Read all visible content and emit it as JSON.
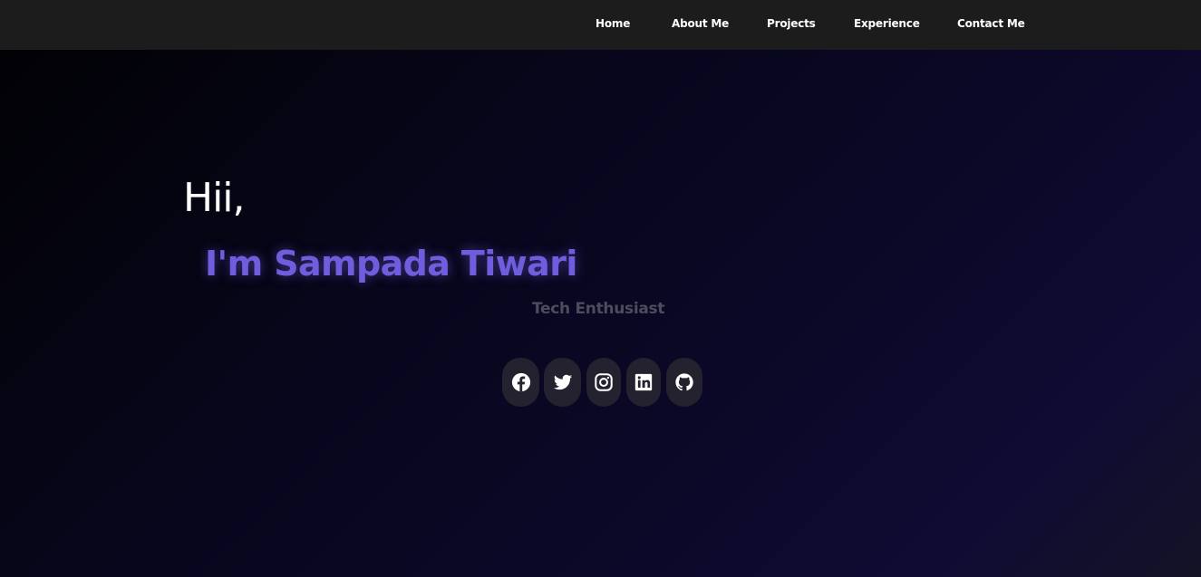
{
  "nav": {
    "items": [
      {
        "label": "Home"
      },
      {
        "label": "About Me"
      },
      {
        "label": "Projects"
      },
      {
        "label": "Experience"
      },
      {
        "label": "Contact Me"
      }
    ]
  },
  "hero": {
    "greeting": "Hii,",
    "name": "I'm Sampada Tiwari",
    "tagline": "Tech Enthusiast"
  },
  "social": {
    "icons": [
      "facebook-icon",
      "twitter-icon",
      "instagram-icon",
      "linkedin-icon",
      "github-icon"
    ]
  },
  "colors": {
    "navbar_bg": "#1c1c1c",
    "accent": "#6e5ddc",
    "tagline": "#4d4b5d",
    "social_bg": "#25222f"
  }
}
